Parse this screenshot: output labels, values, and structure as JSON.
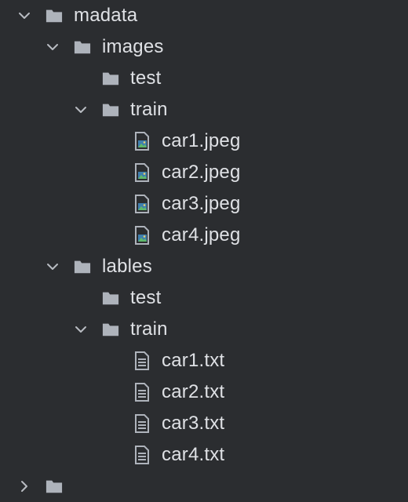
{
  "tree": {
    "madata": "madata",
    "images": "images",
    "images_test": "test",
    "images_train": "train",
    "images_files": [
      "car1.jpeg",
      "car2.jpeg",
      "car3.jpeg",
      "car4.jpeg"
    ],
    "lables": "lables",
    "lables_test": "test",
    "lables_train": "train",
    "lables_files": [
      "car1.txt",
      "car2.txt",
      "car3.txt",
      "car4.txt"
    ]
  },
  "icons": {
    "chevron": "chevron-down-icon",
    "folder": "folder-icon",
    "image_file": "image-file-icon",
    "text_file": "text-file-icon"
  },
  "colors": {
    "background": "#2b2d30",
    "text": "#dfe1e5",
    "folder": "#aeb3bb",
    "chevron": "#b8bcc2"
  }
}
